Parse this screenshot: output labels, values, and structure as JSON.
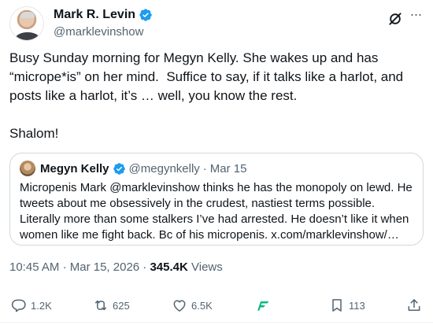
{
  "author": {
    "name": "Mark R. Levin",
    "handle": "@marklevinshow"
  },
  "tweet": {
    "text": "Busy Sunday morning for Megyn Kelly. She wakes up and has “micrope*is” on her mind.  Suffice to say, if it talks like a harlot, and posts like a harlot, it’s … well, you know the rest.\n\nShalom!"
  },
  "quote": {
    "name": "Megyn Kelly",
    "handle": "@megynkelly",
    "separator": "·",
    "date": "Mar 15",
    "text": "Micropenis Mark @marklevinshow thinks he has the monopoly on lewd. He tweets about me obsessively in the crudest, nastiest terms possible. Literally more than some stalkers I’ve had arrested. He doesn’t like it when women like me fight back. Bc of his micropenis. x.com/marklevinshow/…"
  },
  "meta": {
    "time": "10:45 AM",
    "separator": "·",
    "date": "Mar 15, 2026",
    "views_count": "345.4K",
    "views_label": "Views"
  },
  "actions": {
    "replies": "1.2K",
    "reposts": "625",
    "likes": "6.5K",
    "bookmarks": "113"
  },
  "icons": {
    "verified": "verified-badge-icon",
    "grok": "grok-icon",
    "more": "more-icon",
    "reply": "reply-icon",
    "repost": "repost-icon",
    "like": "heart-icon",
    "analytics": "analytics-icon",
    "bookmark": "bookmark-icon",
    "share": "share-icon"
  },
  "colors": {
    "text": "#0f1419",
    "secondary": "#536471",
    "verified": "#1d9bf0",
    "border": "#cfd9de",
    "analytics": "#00ba7c"
  }
}
